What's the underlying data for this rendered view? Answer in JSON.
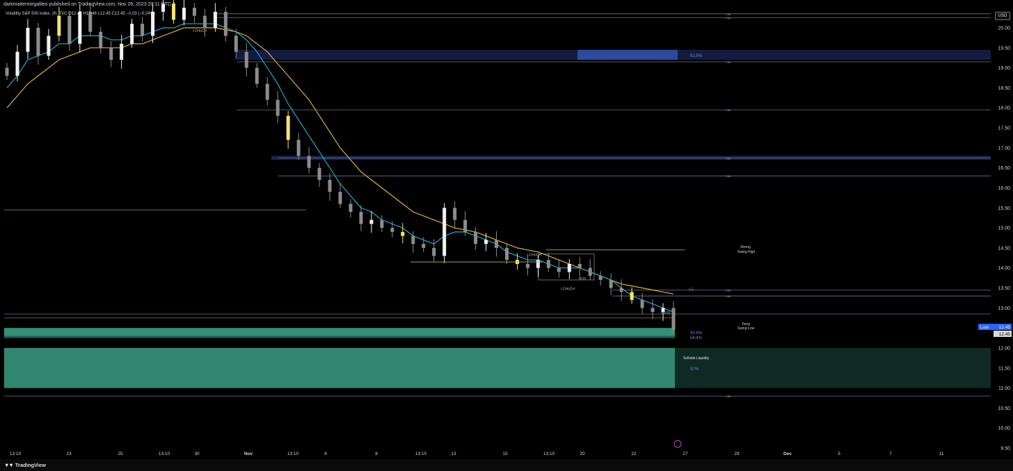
{
  "header": {
    "publisher_line": "darkmattermirgalileo published on TradingView.com, Nov 26, 2023 20:11 UTC-5",
    "symbol_line": "Volatility S&P 500 index, 2h, TVC  O12.47  H12.48  L12.45  C12.45  −0.03 (−0.24%)",
    "currency_button": "USD"
  },
  "footer": {
    "brand": "TradingView"
  },
  "colors": {
    "background": "#000000",
    "up_candle": "#f2f2f2",
    "down_candle": "#8c8c8c",
    "highlight_candle": "#f5e56b",
    "ema_fast": "#22aacc",
    "ema_slow": "#d8b437",
    "zone_blue": "#2a3f8f",
    "zone_green": "#3a9f84",
    "level_line": "#6e7394"
  },
  "chart_data": {
    "type": "candlestick",
    "ylim": [
      9.5,
      20.5
    ],
    "y_ticks": [
      "20.00",
      "19.50",
      "19.00",
      "18.50",
      "18.00",
      "17.50",
      "17.00",
      "16.50",
      "16.00",
      "15.50",
      "15.00",
      "14.50",
      "14.00",
      "13.50",
      "13.00",
      "12.50",
      "12.00",
      "11.50",
      "11.00",
      "10.50",
      "10.00",
      "9.50"
    ],
    "x_ticks": [
      "13:10",
      "23",
      "25",
      "13:10",
      "30",
      "Nov",
      "13:10",
      "6",
      "8",
      "13:10",
      "13",
      "15",
      "13:10",
      "20",
      "22",
      "27",
      "29",
      "Dec",
      "5",
      "7",
      "11"
    ],
    "price_label": {
      "name": "Low",
      "value": "12.45"
    },
    "last_price": "12.45",
    "closes": [
      18.8,
      19.4,
      20.0,
      19.3,
      19.8,
      20.3,
      19.6,
      20.4,
      19.9,
      19.5,
      19.2,
      19.6,
      20.1,
      19.8,
      20.4,
      20.6,
      20.2,
      20.5,
      20.3,
      20.0,
      20.4,
      19.8,
      19.4,
      19.0,
      18.6,
      18.2,
      17.8,
      17.2,
      16.8,
      16.5,
      16.2,
      15.9,
      15.6,
      15.4,
      15.1,
      15.2,
      15.0,
      14.9,
      14.8,
      14.6,
      14.5,
      14.3,
      15.5,
      15.2,
      14.9,
      14.6,
      14.7,
      14.5,
      14.2,
      14.1,
      14.0,
      14.2,
      14.0,
      13.9,
      14.1,
      14.0,
      13.8,
      13.7,
      13.5,
      13.4,
      13.2,
      13.0,
      12.9,
      13.0,
      12.45
    ],
    "ema_fast": [
      18.5,
      18.8,
      19.2,
      19.3,
      19.4,
      19.6,
      19.6,
      19.8,
      19.8,
      19.8,
      19.7,
      19.7,
      19.8,
      19.8,
      19.9,
      20.0,
      20.0,
      20.1,
      20.1,
      20.1,
      20.1,
      20.0,
      19.9,
      19.7,
      19.4,
      19.0,
      18.6,
      18.1,
      17.7,
      17.3,
      16.9,
      16.5,
      16.1,
      15.8,
      15.5,
      15.4,
      15.2,
      15.1,
      15.0,
      14.8,
      14.7,
      14.6,
      14.8,
      14.9,
      14.9,
      14.8,
      14.7,
      14.6,
      14.4,
      14.3,
      14.2,
      14.2,
      14.1,
      14.0,
      14.0,
      14.0,
      13.9,
      13.8,
      13.7,
      13.5,
      13.3,
      13.2,
      13.1,
      13.0,
      12.9
    ],
    "ema_slow": [
      18.0,
      18.3,
      18.6,
      18.8,
      19.0,
      19.2,
      19.3,
      19.4,
      19.5,
      19.5,
      19.5,
      19.5,
      19.6,
      19.6,
      19.7,
      19.8,
      19.9,
      20.0,
      20.0,
      20.0,
      20.0,
      19.95,
      19.9,
      19.8,
      19.6,
      19.4,
      19.1,
      18.8,
      18.5,
      18.2,
      17.8,
      17.4,
      17.0,
      16.7,
      16.4,
      16.2,
      16.0,
      15.8,
      15.6,
      15.4,
      15.3,
      15.2,
      15.1,
      15.0,
      14.95,
      14.9,
      14.8,
      14.7,
      14.6,
      14.5,
      14.45,
      14.4,
      14.3,
      14.2,
      14.1,
      14.0,
      13.9,
      13.8,
      13.7,
      13.6,
      13.55,
      13.5,
      13.45,
      13.4,
      13.35
    ],
    "zones": [
      {
        "label": "51.5%",
        "top": 19.45,
        "bottom": 19.2,
        "color": "blue"
      },
      {
        "label": "",
        "top": 16.8,
        "bottom": 16.7,
        "color": "blue"
      },
      {
        "label": "50.6%",
        "top": 12.5,
        "bottom": 12.3,
        "color": "green"
      },
      {
        "label": "54.4%",
        "top": 12.3,
        "bottom": 12.25,
        "color": "green"
      },
      {
        "label": "57%",
        "top": 12.0,
        "bottom": 11.0,
        "color": "green"
      }
    ],
    "levels": [
      {
        "label": "VIM",
        "price": 20.35
      },
      {
        "label": "VIM",
        "price": 20.25
      },
      {
        "label": "VIM",
        "price": 19.15
      },
      {
        "label": "VIM",
        "price": 17.95
      },
      {
        "label": "VIM",
        "price": 16.75
      },
      {
        "label": "VIM",
        "price": 16.3
      },
      {
        "label": "VIM",
        "price": 13.45
      },
      {
        "label": "VIM",
        "price": 13.3
      },
      {
        "label": "",
        "price": 12.85
      },
      {
        "label": "VIM",
        "price": 10.8
      }
    ],
    "annotations": {
      "strong_high": [
        "Strong",
        "Swing High"
      ],
      "weak_low": [
        "Temp",
        "Swing Low"
      ],
      "liquidity": "Sellside Liquidity",
      "choch_labels": [
        "i-CHoCH",
        "i-CHoCH",
        "i-CHoCH"
      ],
      "bos_labels": [
        "BOS",
        "i-BOS"
      ],
      "fib_label": "0.5"
    }
  }
}
